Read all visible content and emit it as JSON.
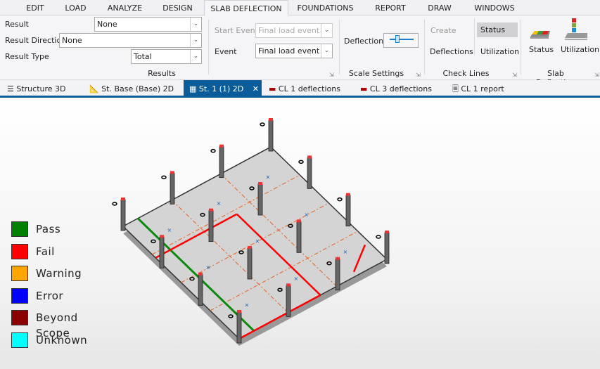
{
  "menu": {
    "tabs": [
      "EDIT",
      "LOAD",
      "ANALYZE",
      "DESIGN",
      "SLAB DEFLECTION",
      "FOUNDATIONS",
      "REPORT",
      "DRAW",
      "WINDOWS"
    ],
    "active": "SLAB DEFLECTION"
  },
  "results": {
    "result_label": "Result",
    "result_value": "None",
    "direction_label": "Result Direction",
    "direction_value": "None",
    "type_label": "Result Type",
    "type_value": "Total",
    "group": "Results"
  },
  "events": {
    "start_label": "Start Event",
    "start_value": "Final load event",
    "event_label": "Event",
    "event_value": "Final load event"
  },
  "scale": {
    "label": "Deflections",
    "group": "Scale Settings"
  },
  "check_lines": {
    "create": "Create",
    "deflections": "Deflections",
    "status": "Status",
    "utilization": "Utilization",
    "group": "Check Lines"
  },
  "slab_deflection": {
    "status": "Status",
    "utilization": "Utilization",
    "group": "Slab Deflection"
  },
  "doc_tabs": [
    "Structure 3D",
    "St. Base (Base) 2D",
    "St. 1 (1) 2D",
    "CL 1 deflections",
    "CL 3 deflections",
    "CL 1 report"
  ],
  "legend": [
    {
      "label": "Pass",
      "color": "#008000"
    },
    {
      "label": "Fail",
      "color": "#ff0000"
    },
    {
      "label": "Warning",
      "color": "#ffa500"
    },
    {
      "label": "Error",
      "color": "#0000ff"
    },
    {
      "label": "Beyond Scope",
      "color": "#8b0000"
    },
    {
      "label": "Unknown",
      "color": "#00ffff"
    }
  ]
}
